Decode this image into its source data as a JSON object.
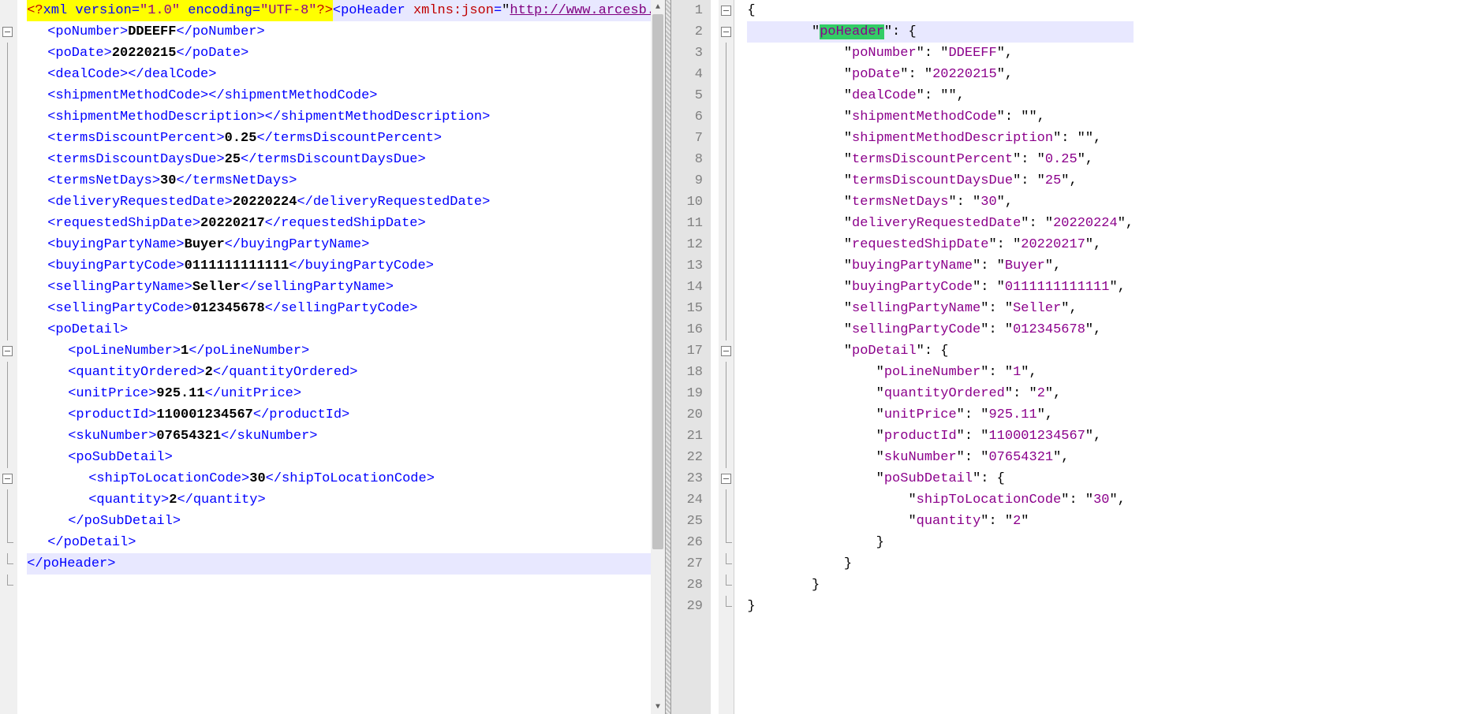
{
  "left": {
    "scroll_thumb_pct": 78,
    "lines": [
      {
        "fold": "none",
        "cls": "hl-yellow",
        "html": "<span class='pi'>&lt;?</span><span class='kw'>xml version=</span><span class='q'>\"1.0\"</span><span class='kw'> encoding=</span><span class='q'>\"UTF-8\"</span><span class='pi'>?&gt;</span>"
      },
      {
        "fold": "box",
        "cls": "hl-blue",
        "html": "<span class='tag'>&lt;poHeader </span><span class='attr'>xmlns:json</span><span class='tag'>=</span>\"<span class='link'>http://www.arcesb.com/ns/jsonconnecto</span>"
      },
      {
        "fold": "line",
        "indent": 1,
        "html": "<span class='tag'>&lt;poNumber&gt;</span><span class='txt'>DDEEFF</span><span class='tag'>&lt;/poNumber&gt;</span>"
      },
      {
        "fold": "line",
        "indent": 1,
        "html": "<span class='tag'>&lt;poDate&gt;</span><span class='txt'>20220215</span><span class='tag'>&lt;/poDate&gt;</span>"
      },
      {
        "fold": "line",
        "indent": 1,
        "html": "<span class='tag'>&lt;dealCode&gt;&lt;/dealCode&gt;</span>"
      },
      {
        "fold": "line",
        "indent": 1,
        "html": "<span class='tag'>&lt;shipmentMethodCode&gt;&lt;/shipmentMethodCode&gt;</span>"
      },
      {
        "fold": "line",
        "indent": 1,
        "html": "<span class='tag'>&lt;shipmentMethodDescription&gt;&lt;/shipmentMethodDescription&gt;</span>"
      },
      {
        "fold": "line",
        "indent": 1,
        "html": "<span class='tag'>&lt;termsDiscountPercent&gt;</span><span class='txt'>0.25</span><span class='tag'>&lt;/termsDiscountPercent&gt;</span>"
      },
      {
        "fold": "line",
        "indent": 1,
        "html": "<span class='tag'>&lt;termsDiscountDaysDue&gt;</span><span class='txt'>25</span><span class='tag'>&lt;/termsDiscountDaysDue&gt;</span>"
      },
      {
        "fold": "line",
        "indent": 1,
        "html": "<span class='tag'>&lt;termsNetDays&gt;</span><span class='txt'>30</span><span class='tag'>&lt;/termsNetDays&gt;</span>"
      },
      {
        "fold": "line",
        "indent": 1,
        "html": "<span class='tag'>&lt;deliveryRequestedDate&gt;</span><span class='txt'>20220224</span><span class='tag'>&lt;/deliveryRequestedDate&gt;</span>"
      },
      {
        "fold": "line",
        "indent": 1,
        "html": "<span class='tag'>&lt;requestedShipDate&gt;</span><span class='txt'>20220217</span><span class='tag'>&lt;/requestedShipDate&gt;</span>"
      },
      {
        "fold": "line",
        "indent": 1,
        "html": "<span class='tag'>&lt;buyingPartyName&gt;</span><span class='txt'>Buyer</span><span class='tag'>&lt;/buyingPartyName&gt;</span>"
      },
      {
        "fold": "line",
        "indent": 1,
        "html": "<span class='tag'>&lt;buyingPartyCode&gt;</span><span class='txt'>0111111111111</span><span class='tag'>&lt;/buyingPartyCode&gt;</span>"
      },
      {
        "fold": "line",
        "indent": 1,
        "html": "<span class='tag'>&lt;sellingPartyName&gt;</span><span class='txt'>Seller</span><span class='tag'>&lt;/sellingPartyName&gt;</span>"
      },
      {
        "fold": "line",
        "indent": 1,
        "html": "<span class='tag'>&lt;sellingPartyCode&gt;</span><span class='txt'>012345678</span><span class='tag'>&lt;/sellingPartyCode&gt;</span>"
      },
      {
        "fold": "box",
        "indent": 1,
        "html": "<span class='tag'>&lt;poDetail&gt;</span>"
      },
      {
        "fold": "line",
        "indent": 2,
        "html": "<span class='tag'>&lt;poLineNumber&gt;</span><span class='txt'>1</span><span class='tag'>&lt;/poLineNumber&gt;</span>"
      },
      {
        "fold": "line",
        "indent": 2,
        "html": "<span class='tag'>&lt;quantityOrdered&gt;</span><span class='txt'>2</span><span class='tag'>&lt;/quantityOrdered&gt;</span>"
      },
      {
        "fold": "line",
        "indent": 2,
        "html": "<span class='tag'>&lt;unitPrice&gt;</span><span class='txt'>925.11</span><span class='tag'>&lt;/unitPrice&gt;</span>"
      },
      {
        "fold": "line",
        "indent": 2,
        "html": "<span class='tag'>&lt;productId&gt;</span><span class='txt'>110001234567</span><span class='tag'>&lt;/productId&gt;</span>"
      },
      {
        "fold": "line",
        "indent": 2,
        "html": "<span class='tag'>&lt;skuNumber&gt;</span><span class='txt'>07654321</span><span class='tag'>&lt;/skuNumber&gt;</span>"
      },
      {
        "fold": "box",
        "indent": 2,
        "html": "<span class='tag'>&lt;poSubDetail&gt;</span>"
      },
      {
        "fold": "line",
        "indent": 3,
        "html": "<span class='tag'>&lt;shipToLocationCode&gt;</span><span class='txt'>30</span><span class='tag'>&lt;/shipToLocationCode&gt;</span>"
      },
      {
        "fold": "line",
        "indent": 3,
        "html": "<span class='tag'>&lt;quantity&gt;</span><span class='txt'>2</span><span class='tag'>&lt;/quantity&gt;</span>"
      },
      {
        "fold": "end",
        "indent": 2,
        "html": "<span class='tag'>&lt;/poSubDetail&gt;</span>"
      },
      {
        "fold": "end",
        "indent": 1,
        "html": "<span class='tag'>&lt;/poDetail&gt;</span>"
      },
      {
        "fold": "end",
        "cls": "hl-blue",
        "html": "<span class='tag'>&lt;/poHeader&gt;</span>"
      }
    ]
  },
  "right": {
    "lines": [
      {
        "n": 1,
        "fold": "box",
        "ind": 0,
        "html": "<span class='brace'>{</span>"
      },
      {
        "n": 2,
        "fold": "box",
        "ind": 2,
        "cls": "row2",
        "html": "<span class='punct'>\"</span><span class='jkey hl-green'>poHeader</span><span class='punct'>\": </span><span class='brace'>{</span>"
      },
      {
        "n": 3,
        "fold": "line",
        "ind": 3,
        "html": "<span class='punct'>\"</span><span class='jkey'>poNumber</span><span class='punct'>\": \"</span><span class='jstr'>DDEEFF</span><span class='punct'>\",</span>"
      },
      {
        "n": 4,
        "fold": "line",
        "ind": 3,
        "html": "<span class='punct'>\"</span><span class='jkey'>poDate</span><span class='punct'>\": \"</span><span class='jstr'>20220215</span><span class='punct'>\",</span>"
      },
      {
        "n": 5,
        "fold": "line",
        "ind": 3,
        "html": "<span class='punct'>\"</span><span class='jkey'>dealCode</span><span class='punct'>\": \"\",</span>"
      },
      {
        "n": 6,
        "fold": "line",
        "ind": 3,
        "html": "<span class='punct'>\"</span><span class='jkey'>shipmentMethodCode</span><span class='punct'>\": \"\",</span>"
      },
      {
        "n": 7,
        "fold": "line",
        "ind": 3,
        "html": "<span class='punct'>\"</span><span class='jkey'>shipmentMethodDescription</span><span class='punct'>\": \"\",</span>"
      },
      {
        "n": 8,
        "fold": "line",
        "ind": 3,
        "html": "<span class='punct'>\"</span><span class='jkey'>termsDiscountPercent</span><span class='punct'>\": \"</span><span class='jstr'>0.25</span><span class='punct'>\",</span>"
      },
      {
        "n": 9,
        "fold": "line",
        "ind": 3,
        "html": "<span class='punct'>\"</span><span class='jkey'>termsDiscountDaysDue</span><span class='punct'>\": \"</span><span class='jstr'>25</span><span class='punct'>\",</span>"
      },
      {
        "n": 10,
        "fold": "line",
        "ind": 3,
        "html": "<span class='punct'>\"</span><span class='jkey'>termsNetDays</span><span class='punct'>\": \"</span><span class='jstr'>30</span><span class='punct'>\",</span>"
      },
      {
        "n": 11,
        "fold": "line",
        "ind": 3,
        "html": "<span class='punct'>\"</span><span class='jkey'>deliveryRequestedDate</span><span class='punct'>\": \"</span><span class='jstr'>20220224</span><span class='punct'>\",</span>"
      },
      {
        "n": 12,
        "fold": "line",
        "ind": 3,
        "html": "<span class='punct'>\"</span><span class='jkey'>requestedShipDate</span><span class='punct'>\": \"</span><span class='jstr'>20220217</span><span class='punct'>\",</span>"
      },
      {
        "n": 13,
        "fold": "line",
        "ind": 3,
        "html": "<span class='punct'>\"</span><span class='jkey'>buyingPartyName</span><span class='punct'>\": \"</span><span class='jstr'>Buyer</span><span class='punct'>\",</span>"
      },
      {
        "n": 14,
        "fold": "line",
        "ind": 3,
        "html": "<span class='punct'>\"</span><span class='jkey'>buyingPartyCode</span><span class='punct'>\": \"</span><span class='jstr'>0111111111111</span><span class='punct'>\",</span>"
      },
      {
        "n": 15,
        "fold": "line",
        "ind": 3,
        "html": "<span class='punct'>\"</span><span class='jkey'>sellingPartyName</span><span class='punct'>\": \"</span><span class='jstr'>Seller</span><span class='punct'>\",</span>"
      },
      {
        "n": 16,
        "fold": "line",
        "ind": 3,
        "html": "<span class='punct'>\"</span><span class='jkey'>sellingPartyCode</span><span class='punct'>\": \"</span><span class='jstr'>012345678</span><span class='punct'>\",</span>"
      },
      {
        "n": 17,
        "fold": "box",
        "ind": 3,
        "html": "<span class='punct'>\"</span><span class='jkey'>poDetail</span><span class='punct'>\": </span><span class='brace'>{</span>"
      },
      {
        "n": 18,
        "fold": "line",
        "ind": 4,
        "html": "<span class='punct'>\"</span><span class='jkey'>poLineNumber</span><span class='punct'>\": \"</span><span class='jstr'>1</span><span class='punct'>\",</span>"
      },
      {
        "n": 19,
        "fold": "line",
        "ind": 4,
        "html": "<span class='punct'>\"</span><span class='jkey'>quantityOrdered</span><span class='punct'>\": \"</span><span class='jstr'>2</span><span class='punct'>\",</span>"
      },
      {
        "n": 20,
        "fold": "line",
        "ind": 4,
        "html": "<span class='punct'>\"</span><span class='jkey'>unitPrice</span><span class='punct'>\": \"</span><span class='jstr'>925.11</span><span class='punct'>\",</span>"
      },
      {
        "n": 21,
        "fold": "line",
        "ind": 4,
        "html": "<span class='punct'>\"</span><span class='jkey'>productId</span><span class='punct'>\": \"</span><span class='jstr'>110001234567</span><span class='punct'>\",</span>"
      },
      {
        "n": 22,
        "fold": "line",
        "ind": 4,
        "html": "<span class='punct'>\"</span><span class='jkey'>skuNumber</span><span class='punct'>\": \"</span><span class='jstr'>07654321</span><span class='punct'>\",</span>"
      },
      {
        "n": 23,
        "fold": "box",
        "ind": 4,
        "html": "<span class='punct'>\"</span><span class='jkey'>poSubDetail</span><span class='punct'>\": </span><span class='brace'>{</span>"
      },
      {
        "n": 24,
        "fold": "line",
        "ind": 5,
        "html": "<span class='punct'>\"</span><span class='jkey'>shipToLocationCode</span><span class='punct'>\": \"</span><span class='jstr'>30</span><span class='punct'>\",</span>"
      },
      {
        "n": 25,
        "fold": "line",
        "ind": 5,
        "html": "<span class='punct'>\"</span><span class='jkey'>quantity</span><span class='punct'>\": \"</span><span class='jstr'>2</span><span class='punct'>\"</span>"
      },
      {
        "n": 26,
        "fold": "end",
        "ind": 4,
        "html": "<span class='brace'>}</span>"
      },
      {
        "n": 27,
        "fold": "end",
        "ind": 3,
        "html": "<span class='brace'>}</span>"
      },
      {
        "n": 28,
        "fold": "end",
        "ind": 2,
        "html": "<span class='brace'>}</span>"
      },
      {
        "n": 29,
        "fold": "end",
        "ind": 0,
        "html": "<span class='brace'>}</span>"
      }
    ]
  }
}
